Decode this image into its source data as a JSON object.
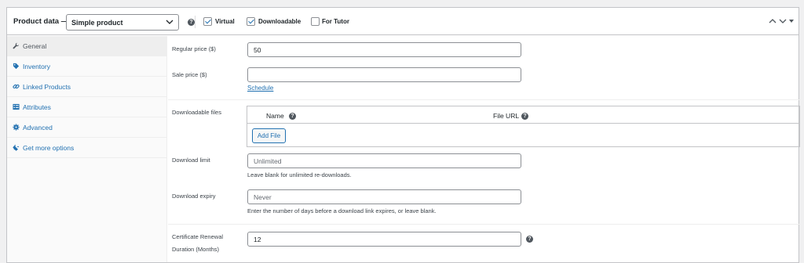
{
  "header": {
    "title": "Product data —",
    "product_type": "Simple product",
    "virtual_label": "Virtual",
    "virtual_checked": true,
    "downloadable_label": "Downloadable",
    "downloadable_checked": true,
    "for_tutor_label": "For Tutor",
    "for_tutor_checked": false
  },
  "sidebar": {
    "items": [
      {
        "label": "General",
        "icon": "wrench-icon",
        "active": true
      },
      {
        "label": "Inventory",
        "icon": "tag-icon"
      },
      {
        "label": "Linked Products",
        "icon": "link-icon"
      },
      {
        "label": "Attributes",
        "icon": "list-icon"
      },
      {
        "label": "Advanced",
        "icon": "gear-icon"
      },
      {
        "label": "Get more options",
        "icon": "plugin-icon"
      }
    ]
  },
  "general": {
    "regular_price_label": "Regular price ($)",
    "regular_price_value": "50",
    "sale_price_label": "Sale price ($)",
    "sale_price_value": "",
    "schedule_link": "Schedule",
    "downloadable_files_label": "Downloadable files",
    "files_col_name": "Name",
    "files_col_url": "File URL",
    "add_file_button": "Add File",
    "download_limit_label": "Download limit",
    "download_limit_placeholder": "Unlimited",
    "download_limit_hint": "Leave blank for unlimited re-downloads.",
    "download_expiry_label": "Download expiry",
    "download_expiry_placeholder": "Never",
    "download_expiry_hint": "Enter the number of days before a download link expires, or leave blank.",
    "cert_label_line1": "Certificate Renewal",
    "cert_label_line2": "Duration (Months)",
    "cert_value": "12"
  },
  "colors": {
    "link": "#2271b1",
    "border": "#c3c4c7"
  }
}
